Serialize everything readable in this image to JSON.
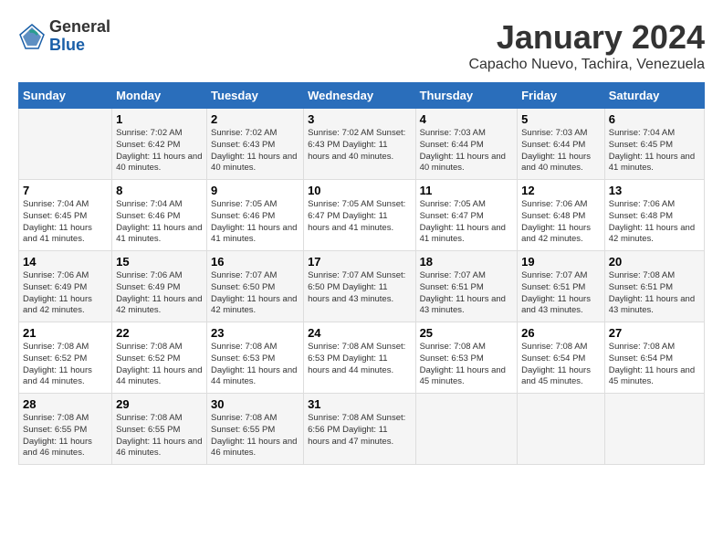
{
  "header": {
    "logo_general": "General",
    "logo_blue": "Blue",
    "month_title": "January 2024",
    "location": "Capacho Nuevo, Tachira, Venezuela"
  },
  "days_of_week": [
    "Sunday",
    "Monday",
    "Tuesday",
    "Wednesday",
    "Thursday",
    "Friday",
    "Saturday"
  ],
  "weeks": [
    [
      {
        "day": "",
        "info": ""
      },
      {
        "day": "1",
        "info": "Sunrise: 7:02 AM\nSunset: 6:42 PM\nDaylight: 11 hours\nand 40 minutes."
      },
      {
        "day": "2",
        "info": "Sunrise: 7:02 AM\nSunset: 6:43 PM\nDaylight: 11 hours\nand 40 minutes."
      },
      {
        "day": "3",
        "info": "Sunrise: 7:02 AM\nSunset: 6:43 PM\nDaylight: 11 hours\nand 40 minutes."
      },
      {
        "day": "4",
        "info": "Sunrise: 7:03 AM\nSunset: 6:44 PM\nDaylight: 11 hours\nand 40 minutes."
      },
      {
        "day": "5",
        "info": "Sunrise: 7:03 AM\nSunset: 6:44 PM\nDaylight: 11 hours\nand 40 minutes."
      },
      {
        "day": "6",
        "info": "Sunrise: 7:04 AM\nSunset: 6:45 PM\nDaylight: 11 hours\nand 41 minutes."
      }
    ],
    [
      {
        "day": "7",
        "info": "Sunrise: 7:04 AM\nSunset: 6:45 PM\nDaylight: 11 hours\nand 41 minutes."
      },
      {
        "day": "8",
        "info": "Sunrise: 7:04 AM\nSunset: 6:46 PM\nDaylight: 11 hours\nand 41 minutes."
      },
      {
        "day": "9",
        "info": "Sunrise: 7:05 AM\nSunset: 6:46 PM\nDaylight: 11 hours\nand 41 minutes."
      },
      {
        "day": "10",
        "info": "Sunrise: 7:05 AM\nSunset: 6:47 PM\nDaylight: 11 hours\nand 41 minutes."
      },
      {
        "day": "11",
        "info": "Sunrise: 7:05 AM\nSunset: 6:47 PM\nDaylight: 11 hours\nand 41 minutes."
      },
      {
        "day": "12",
        "info": "Sunrise: 7:06 AM\nSunset: 6:48 PM\nDaylight: 11 hours\nand 42 minutes."
      },
      {
        "day": "13",
        "info": "Sunrise: 7:06 AM\nSunset: 6:48 PM\nDaylight: 11 hours\nand 42 minutes."
      }
    ],
    [
      {
        "day": "14",
        "info": "Sunrise: 7:06 AM\nSunset: 6:49 PM\nDaylight: 11 hours\nand 42 minutes."
      },
      {
        "day": "15",
        "info": "Sunrise: 7:06 AM\nSunset: 6:49 PM\nDaylight: 11 hours\nand 42 minutes."
      },
      {
        "day": "16",
        "info": "Sunrise: 7:07 AM\nSunset: 6:50 PM\nDaylight: 11 hours\nand 42 minutes."
      },
      {
        "day": "17",
        "info": "Sunrise: 7:07 AM\nSunset: 6:50 PM\nDaylight: 11 hours\nand 43 minutes."
      },
      {
        "day": "18",
        "info": "Sunrise: 7:07 AM\nSunset: 6:51 PM\nDaylight: 11 hours\nand 43 minutes."
      },
      {
        "day": "19",
        "info": "Sunrise: 7:07 AM\nSunset: 6:51 PM\nDaylight: 11 hours\nand 43 minutes."
      },
      {
        "day": "20",
        "info": "Sunrise: 7:08 AM\nSunset: 6:51 PM\nDaylight: 11 hours\nand 43 minutes."
      }
    ],
    [
      {
        "day": "21",
        "info": "Sunrise: 7:08 AM\nSunset: 6:52 PM\nDaylight: 11 hours\nand 44 minutes."
      },
      {
        "day": "22",
        "info": "Sunrise: 7:08 AM\nSunset: 6:52 PM\nDaylight: 11 hours\nand 44 minutes."
      },
      {
        "day": "23",
        "info": "Sunrise: 7:08 AM\nSunset: 6:53 PM\nDaylight: 11 hours\nand 44 minutes."
      },
      {
        "day": "24",
        "info": "Sunrise: 7:08 AM\nSunset: 6:53 PM\nDaylight: 11 hours\nand 44 minutes."
      },
      {
        "day": "25",
        "info": "Sunrise: 7:08 AM\nSunset: 6:53 PM\nDaylight: 11 hours\nand 45 minutes."
      },
      {
        "day": "26",
        "info": "Sunrise: 7:08 AM\nSunset: 6:54 PM\nDaylight: 11 hours\nand 45 minutes."
      },
      {
        "day": "27",
        "info": "Sunrise: 7:08 AM\nSunset: 6:54 PM\nDaylight: 11 hours\nand 45 minutes."
      }
    ],
    [
      {
        "day": "28",
        "info": "Sunrise: 7:08 AM\nSunset: 6:55 PM\nDaylight: 11 hours\nand 46 minutes."
      },
      {
        "day": "29",
        "info": "Sunrise: 7:08 AM\nSunset: 6:55 PM\nDaylight: 11 hours\nand 46 minutes."
      },
      {
        "day": "30",
        "info": "Sunrise: 7:08 AM\nSunset: 6:55 PM\nDaylight: 11 hours\nand 46 minutes."
      },
      {
        "day": "31",
        "info": "Sunrise: 7:08 AM\nSunset: 6:56 PM\nDaylight: 11 hours\nand 47 minutes."
      },
      {
        "day": "",
        "info": ""
      },
      {
        "day": "",
        "info": ""
      },
      {
        "day": "",
        "info": ""
      }
    ]
  ]
}
